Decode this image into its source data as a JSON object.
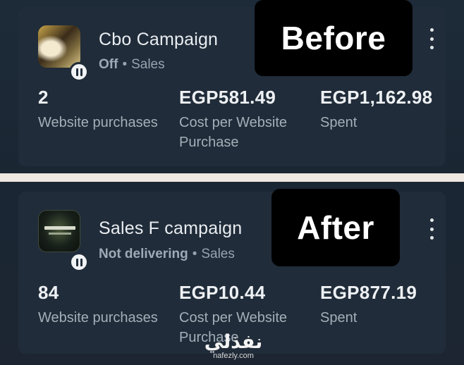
{
  "before_card": {
    "campaign_name": "Cbo Campaign",
    "status": "Off",
    "objective": "Sales",
    "dot": "•",
    "tag": "Before",
    "thumbnail_icon": "campaign-thumbnail",
    "badge_icon": "pause-icon",
    "menu_icon": "more-vertical-icon",
    "stats": [
      {
        "value": "2",
        "label": "Website purchases"
      },
      {
        "value": "EGP581.49",
        "label": "Cost per Website Purchase"
      },
      {
        "value": "EGP1,162.98",
        "label": "Spent"
      }
    ]
  },
  "after_card": {
    "campaign_name": "Sales F campaign",
    "status": "Not delivering",
    "objective": "Sales",
    "dot": "•",
    "tag": "After",
    "thumbnail_icon": "campaign-thumbnail",
    "badge_icon": "pause-icon",
    "menu_icon": "more-vertical-icon",
    "stats": [
      {
        "value": "84",
        "label": "Website purchases"
      },
      {
        "value": "EGP10.44",
        "label": "Cost per Website Purchase"
      },
      {
        "value": "EGP877.19",
        "label": "Spent"
      }
    ]
  },
  "watermark": {
    "arabic": "نفذلي",
    "latin": "nafezly.com"
  },
  "colors": {
    "background": "#1a2430",
    "card": "#202c39",
    "divider": "#efe7e2",
    "tag_background": "#000000"
  }
}
